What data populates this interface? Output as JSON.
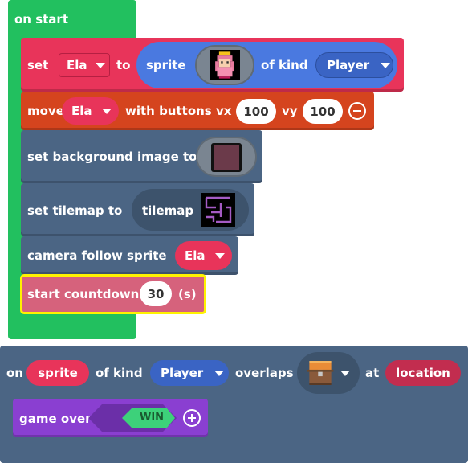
{
  "on_start": {
    "hat_label": "on start",
    "set_sprite": {
      "set_label": "set",
      "variable": "Ela",
      "to_label": "to",
      "sprite_label": "sprite",
      "of_kind_label": "of kind",
      "kind": "Player"
    },
    "move": {
      "move_label": "move",
      "variable": "Ela",
      "with_buttons_label": "with buttons",
      "vx_label": "vx",
      "vx_value": "100",
      "vy_label": "vy",
      "vy_value": "100"
    },
    "background": {
      "label": "set background image to"
    },
    "tilemap": {
      "label": "set tilemap to",
      "tilemap_label": "tilemap"
    },
    "camera": {
      "label": "camera follow sprite",
      "variable": "Ela"
    },
    "countdown": {
      "label": "start countdown",
      "value": "30",
      "unit": "(s)"
    }
  },
  "overlap": {
    "on_label": "on",
    "sprite_var": "sprite",
    "of_kind_label": "of kind",
    "kind": "Player",
    "overlaps_label": "overlaps",
    "at_label": "at",
    "location_var": "location",
    "game_over": {
      "label": "game over",
      "win_label": "WIN"
    }
  },
  "colors": {
    "loops_green": "#22c05f",
    "sprites_red": "#e8345a",
    "sprites_blue": "#4a79e0",
    "controller_orange": "#d5441e",
    "scene_blue": "#4b6584",
    "info_pink": "#d6627c",
    "game_purple": "#8a3fd1",
    "highlight_yellow": "#fff200"
  },
  "icons": {
    "sprite_image": "princess-sprite-icon",
    "background_image": "background-thumbnail-icon",
    "tilemap_image": "tilemap-thumbnail-icon",
    "location_tile": "treasure-chest-icon"
  }
}
